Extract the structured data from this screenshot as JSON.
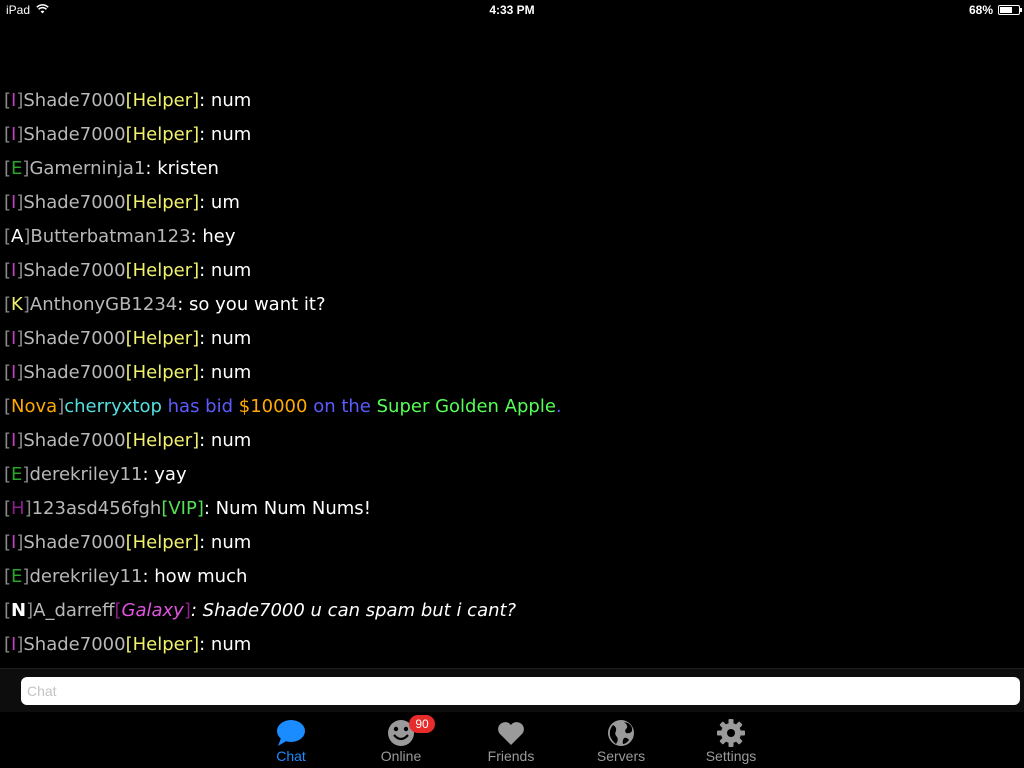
{
  "status_bar": {
    "device": "iPad",
    "time": "4:33 PM",
    "battery": "68%",
    "battery_level": 0.68
  },
  "chat": {
    "messages": [
      {
        "parts": [
          {
            "t": "[",
            "c": "br"
          },
          {
            "t": "I",
            "c": "c-purple"
          },
          {
            "t": "]",
            "c": "br"
          },
          {
            "t": "Shade7000",
            "c": "c-gray"
          },
          {
            "t": "[Helper]",
            "c": "c-yellow"
          },
          {
            "t": ": num",
            "c": "c-white"
          }
        ]
      },
      {
        "parts": [
          {
            "t": "[",
            "c": "br"
          },
          {
            "t": "I",
            "c": "c-purple"
          },
          {
            "t": "]",
            "c": "br"
          },
          {
            "t": "Shade7000",
            "c": "c-gray"
          },
          {
            "t": "[Helper]",
            "c": "c-yellow"
          },
          {
            "t": ": num",
            "c": "c-white"
          }
        ]
      },
      {
        "parts": [
          {
            "t": "[",
            "c": "br"
          },
          {
            "t": "E",
            "c": "c-green"
          },
          {
            "t": "]",
            "c": "br"
          },
          {
            "t": "Gamerninja1",
            "c": "c-gray"
          },
          {
            "t": ": kristen",
            "c": "c-white"
          }
        ]
      },
      {
        "parts": [
          {
            "t": "[",
            "c": "br"
          },
          {
            "t": "I",
            "c": "c-purple"
          },
          {
            "t": "]",
            "c": "br"
          },
          {
            "t": "Shade7000",
            "c": "c-gray"
          },
          {
            "t": "[Helper]",
            "c": "c-yellow"
          },
          {
            "t": ": um",
            "c": "c-white"
          }
        ]
      },
      {
        "parts": [
          {
            "t": "[",
            "c": "br"
          },
          {
            "t": "A",
            "c": "c-white"
          },
          {
            "t": "]",
            "c": "br"
          },
          {
            "t": "Butterbatman123",
            "c": "c-gray"
          },
          {
            "t": ": hey",
            "c": "c-white"
          }
        ]
      },
      {
        "parts": [
          {
            "t": "[",
            "c": "br"
          },
          {
            "t": "I",
            "c": "c-purple"
          },
          {
            "t": "]",
            "c": "br"
          },
          {
            "t": "Shade7000",
            "c": "c-gray"
          },
          {
            "t": "[Helper]",
            "c": "c-yellow"
          },
          {
            "t": ": num",
            "c": "c-white"
          }
        ]
      },
      {
        "parts": [
          {
            "t": "[",
            "c": "br"
          },
          {
            "t": "K",
            "c": "c-yellow"
          },
          {
            "t": "]",
            "c": "br"
          },
          {
            "t": "AnthonyGB1234",
            "c": "c-gray"
          },
          {
            "t": ": so you want it?",
            "c": "c-white"
          }
        ]
      },
      {
        "parts": [
          {
            "t": "[",
            "c": "br"
          },
          {
            "t": "I",
            "c": "c-purple"
          },
          {
            "t": "]",
            "c": "br"
          },
          {
            "t": "Shade7000",
            "c": "c-gray"
          },
          {
            "t": "[Helper]",
            "c": "c-yellow"
          },
          {
            "t": ": num",
            "c": "c-white"
          }
        ]
      },
      {
        "parts": [
          {
            "t": "[",
            "c": "br"
          },
          {
            "t": "I",
            "c": "c-purple"
          },
          {
            "t": "]",
            "c": "br"
          },
          {
            "t": "Shade7000",
            "c": "c-gray"
          },
          {
            "t": "[Helper]",
            "c": "c-yellow"
          },
          {
            "t": ": num",
            "c": "c-white"
          }
        ]
      },
      {
        "parts": [
          {
            "t": "[",
            "c": "br"
          },
          {
            "t": "Nova",
            "c": "c-orange"
          },
          {
            "t": "]",
            "c": "br"
          },
          {
            "t": "cherryxtop",
            "c": "c-cyan"
          },
          {
            "t": " has bid ",
            "c": "c-blue"
          },
          {
            "t": "$10000",
            "c": "c-orange"
          },
          {
            "t": " on the ",
            "c": "c-blue"
          },
          {
            "t": "Super Golden Apple",
            "c": "c-lgreen"
          },
          {
            "t": ".",
            "c": "c-blue"
          }
        ]
      },
      {
        "parts": [
          {
            "t": "[",
            "c": "br"
          },
          {
            "t": "I",
            "c": "c-purple"
          },
          {
            "t": "]",
            "c": "br"
          },
          {
            "t": "Shade7000",
            "c": "c-gray"
          },
          {
            "t": "[Helper]",
            "c": "c-yellow"
          },
          {
            "t": ": num",
            "c": "c-white"
          }
        ]
      },
      {
        "parts": [
          {
            "t": "[",
            "c": "br"
          },
          {
            "t": "E",
            "c": "c-green"
          },
          {
            "t": "]",
            "c": "br"
          },
          {
            "t": "derekriley11",
            "c": "c-gray"
          },
          {
            "t": ": yay",
            "c": "c-white"
          }
        ]
      },
      {
        "parts": [
          {
            "t": "[",
            "c": "br"
          },
          {
            "t": "H",
            "c": "c-darkpurple"
          },
          {
            "t": "]",
            "c": "br"
          },
          {
            "t": "123asd456fgh",
            "c": "c-gray"
          },
          {
            "t": "[VIP]",
            "c": "c-vip"
          },
          {
            "t": ": Num Num Nums!",
            "c": "c-white"
          }
        ]
      },
      {
        "parts": [
          {
            "t": "[",
            "c": "br"
          },
          {
            "t": "I",
            "c": "c-purple"
          },
          {
            "t": "]",
            "c": "br"
          },
          {
            "t": "Shade7000",
            "c": "c-gray"
          },
          {
            "t": "[Helper]",
            "c": "c-yellow"
          },
          {
            "t": ": num",
            "c": "c-white"
          }
        ]
      },
      {
        "parts": [
          {
            "t": "[",
            "c": "br"
          },
          {
            "t": "E",
            "c": "c-green"
          },
          {
            "t": "]",
            "c": "br"
          },
          {
            "t": "derekriley11",
            "c": "c-gray"
          },
          {
            "t": ": how much",
            "c": "c-white"
          }
        ]
      },
      {
        "parts": [
          {
            "t": "[",
            "c": "br"
          },
          {
            "t": "N",
            "c": "c-white bold"
          },
          {
            "t": "]",
            "c": "br"
          },
          {
            "t": "A_darreff",
            "c": "c-gray"
          },
          {
            "t": "[",
            "c": "c-darkpurple"
          },
          {
            "t": "Galaxy",
            "c": "c-magenta italic"
          },
          {
            "t": "]",
            "c": "c-darkpurple"
          },
          {
            "t": ": Shade7000 u can spam but i cant?",
            "c": "c-white italic"
          }
        ]
      },
      {
        "parts": [
          {
            "t": "[",
            "c": "br"
          },
          {
            "t": "I",
            "c": "c-purple"
          },
          {
            "t": "]",
            "c": "br"
          },
          {
            "t": "Shade7000",
            "c": "c-gray"
          },
          {
            "t": "[Helper]",
            "c": "c-yellow"
          },
          {
            "t": ": num",
            "c": "c-white"
          }
        ]
      }
    ]
  },
  "input": {
    "placeholder": "Chat",
    "value": ""
  },
  "tabs": [
    {
      "label": "Chat",
      "icon": "chat-bubble-icon",
      "active": true
    },
    {
      "label": "Online",
      "icon": "smiley-icon",
      "badge": "90"
    },
    {
      "label": "Friends",
      "icon": "heart-icon"
    },
    {
      "label": "Servers",
      "icon": "globe-icon"
    },
    {
      "label": "Settings",
      "icon": "gear-icon"
    }
  ],
  "colors": {
    "accent": "#1b8cff",
    "badge": "#e82c2c",
    "inactive_tab": "#9a9a9a"
  }
}
